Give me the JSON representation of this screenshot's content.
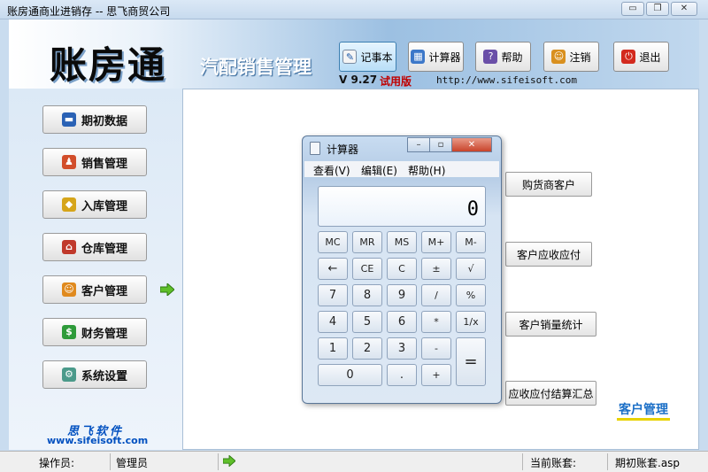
{
  "window": {
    "title": "账房通商业进销存 -- 思飞商贸公司",
    "controls": [
      "▭",
      "❐",
      "✕"
    ]
  },
  "header": {
    "logo": "账房通",
    "subtitle": "汽配销售管理",
    "version": "V 9.27",
    "trial": "试用版",
    "url": "http://www.sifeisoft.com"
  },
  "toolbar": [
    {
      "label": "记事本",
      "icon": "notepad-icon"
    },
    {
      "label": "计算器",
      "icon": "calculator-icon"
    },
    {
      "label": "帮助",
      "icon": "help-icon"
    },
    {
      "label": "注销",
      "icon": "users-icon"
    },
    {
      "label": "退出",
      "icon": "power-icon"
    }
  ],
  "nav": [
    {
      "label": "期初数据",
      "icon": "book-icon"
    },
    {
      "label": "销售管理",
      "icon": "sales-person-icon"
    },
    {
      "label": "入库管理",
      "icon": "box-icon"
    },
    {
      "label": "仓库管理",
      "icon": "warehouse-icon"
    },
    {
      "label": "客户管理",
      "icon": "customers-icon"
    },
    {
      "label": "财务管理",
      "icon": "money-icon"
    },
    {
      "label": "系统设置",
      "icon": "settings-icon"
    }
  ],
  "brand": {
    "name": "思飞软件",
    "url": "www.sifeisoft.com"
  },
  "content": {
    "buttons": [
      "购货商客户",
      "客户应收应付",
      "客户销量统计",
      "应收应付结算汇总"
    ],
    "section_tag": "客户管理"
  },
  "statusbar": {
    "operator_label": "操作员:",
    "operator_value": "管理员",
    "account_label": "当前账套:",
    "account_value": "期初账套.asp"
  },
  "calculator": {
    "title": "计算器",
    "menu": [
      "查看(V)",
      "编辑(E)",
      "帮助(H)"
    ],
    "display": "0",
    "keys": [
      [
        "MC",
        "MR",
        "MS",
        "M+",
        "M-"
      ],
      [
        "←",
        "CE",
        "C",
        "±",
        "√"
      ],
      [
        "7",
        "8",
        "9",
        "/",
        "%"
      ],
      [
        "4",
        "5",
        "6",
        "*",
        "1/x"
      ],
      [
        "1",
        "2",
        "3",
        "-",
        "="
      ],
      [
        "0",
        ".",
        "+"
      ]
    ]
  }
}
